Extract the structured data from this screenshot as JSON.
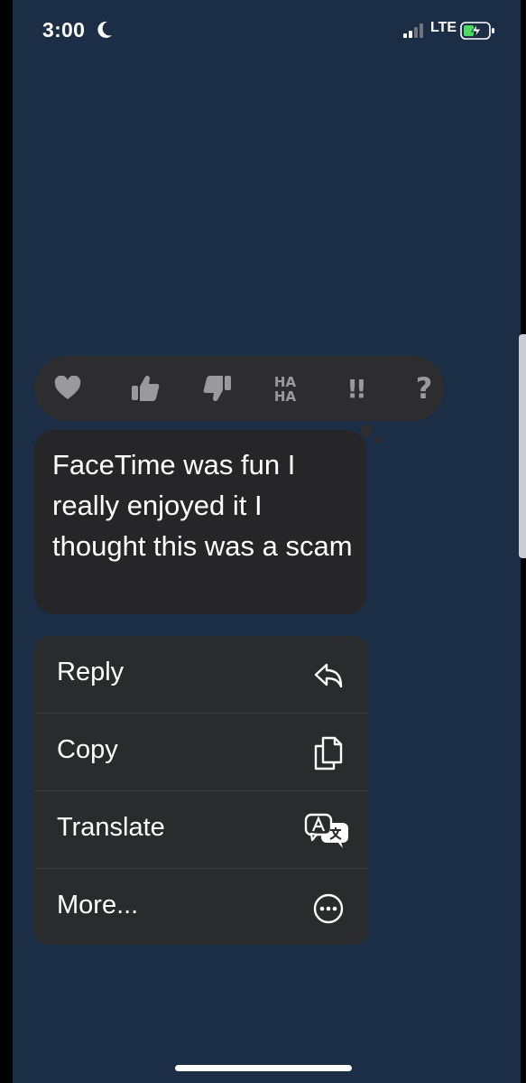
{
  "status_bar": {
    "time": "3:00",
    "network": "LTE",
    "moon_icon": "moon-icon",
    "signal_icon": "signal-icon",
    "battery_icon": "battery-charging-icon"
  },
  "reactions": {
    "items": [
      {
        "name": "heart",
        "icon": "heart-icon"
      },
      {
        "name": "thumbs-up",
        "icon": "thumbs-up-icon"
      },
      {
        "name": "thumbs-down",
        "icon": "thumbs-down-icon"
      },
      {
        "name": "haha",
        "icon": "haha-icon",
        "text_top": "HA",
        "text_bottom": "HA"
      },
      {
        "name": "emphasize",
        "icon": "double-exclamation-icon",
        "text": "!!"
      },
      {
        "name": "question",
        "icon": "question-icon",
        "text": "?"
      }
    ]
  },
  "message": {
    "text": "FaceTime was fun I really enjoyed it I thought this was a scam"
  },
  "menu": {
    "items": [
      {
        "label": "Reply",
        "icon": "reply-icon"
      },
      {
        "label": "Copy",
        "icon": "copy-icon"
      },
      {
        "label": "Translate",
        "icon": "translate-icon"
      },
      {
        "label": "More...",
        "icon": "more-icon"
      }
    ]
  },
  "colors": {
    "background": "#1b2e45",
    "bubble": "#262628",
    "menu": "#2a2b2d",
    "reaction_icon": "#9a9a9e"
  }
}
